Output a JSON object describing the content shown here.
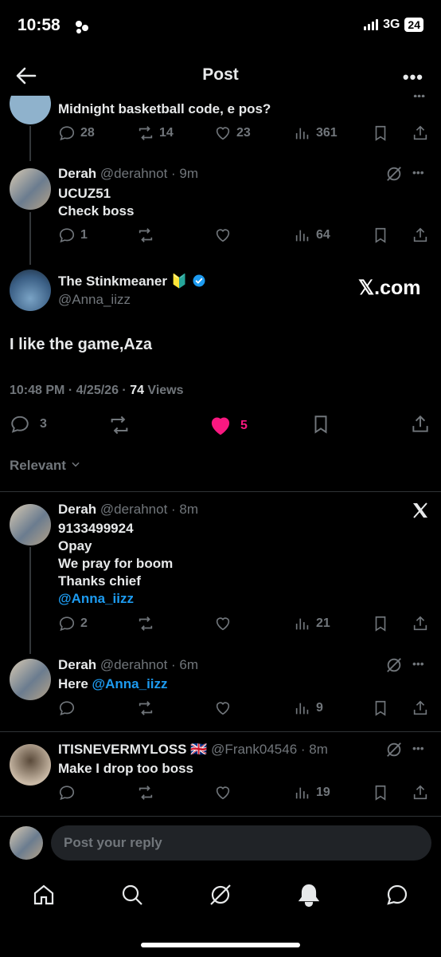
{
  "status_bar": {
    "time": "10:58",
    "network": "3G",
    "battery": "24"
  },
  "header": {
    "title": "Post"
  },
  "prev_tweet": {
    "text": "Midnight basketball code, e pos?",
    "replies": "28",
    "reposts": "14",
    "likes": "23",
    "views": "361"
  },
  "reply1": {
    "name": "Derah",
    "handle": "@derahnot",
    "time": "· 9m",
    "lines": [
      "UCUZ51",
      "Check boss"
    ],
    "replies": "1",
    "views": "64"
  },
  "main_tweet": {
    "name": "The Stinkmeaner",
    "badge": "🔰",
    "handle": "@Anna_iizz",
    "watermark": "𝕏.com",
    "text": "I like the game,Aza",
    "timestamp": "10:48 PM · 4/25/26 · ",
    "views_count": "74",
    "views_label": " Views",
    "replies": "3",
    "likes": "5"
  },
  "sort": {
    "label": "Relevant"
  },
  "reply2": {
    "name": "Derah",
    "handle": "@derahnot",
    "time": "· 8m",
    "lines": [
      "9133499924",
      "Opay",
      "We pray for boom",
      "Thanks chief"
    ],
    "mention": "@Anna_iizz",
    "replies": "2",
    "views": "21"
  },
  "reply3": {
    "name": "Derah",
    "handle": "@derahnot",
    "time": "· 6m",
    "text": "Here ",
    "mention": "@Anna_iizz",
    "views": "9"
  },
  "reply4": {
    "name": "ITISNEVERMYLOSS",
    "flag": "🇬🇧",
    "handle": "@Frank04546",
    "time": "· 8m",
    "text": "Make I drop too boss",
    "views": "19"
  },
  "reply_box": {
    "placeholder": "Post your reply"
  },
  "colors": {
    "accent": "#1d9bf0",
    "like": "#f91880",
    "background": "#000000"
  }
}
